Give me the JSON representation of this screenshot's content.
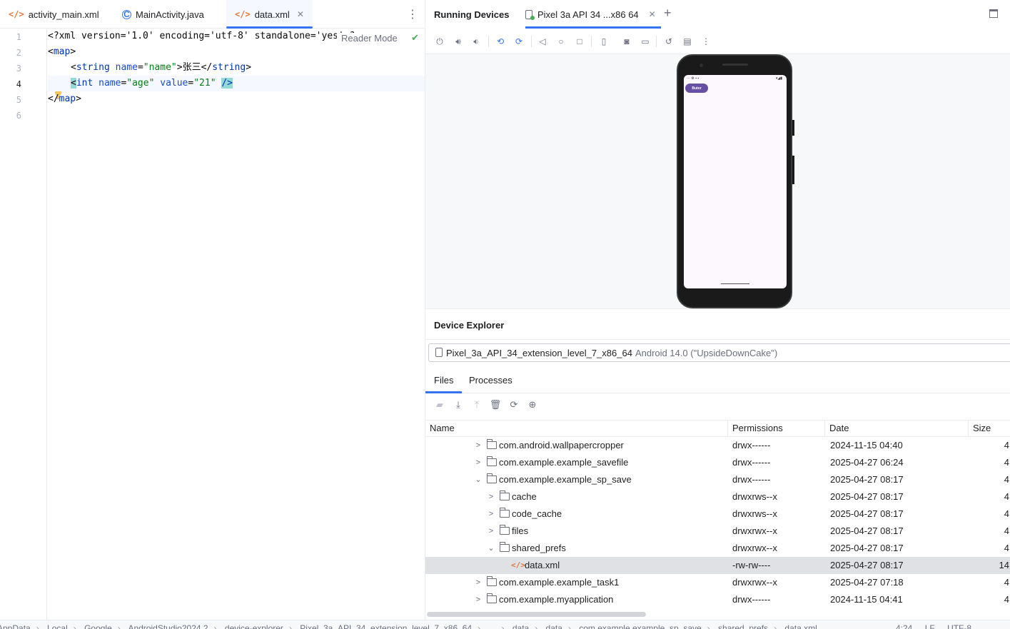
{
  "editor": {
    "tabs": [
      {
        "label": "activity_main.xml",
        "icon": "xml-file-icon",
        "active": false
      },
      {
        "label": "MainActivity.java",
        "icon": "java-class-icon",
        "active": false
      },
      {
        "label": "data.xml",
        "icon": "xml-file-icon",
        "active": true
      }
    ],
    "reader_mode": "Reader Mode",
    "line_numbers": [
      "1",
      "2",
      "3",
      "4",
      "5",
      "6"
    ],
    "current_line": 4,
    "lines": {
      "l1": "<?xml version='1.0' encoding='utf-8' standalone='yes' ?>",
      "l2_open": "<",
      "l2_tag": "map",
      "l2_close": ">",
      "l3_open": "<",
      "l3_tag": "string",
      "l3_attr": "name",
      "l3_eq": "=",
      "l3_val": "\"name\"",
      "l3_close": ">",
      "l3_text": "张三",
      "l3_end_open": "</",
      "l3_end_tag": "string",
      "l3_end_close": ">",
      "l4_open": "<",
      "l4_tag": "int",
      "l4_attr1": "name",
      "l4_eq1": "=",
      "l4_val1": "\"age\"",
      "l4_attr2": "value",
      "l4_eq2": "=",
      "l4_val2": "\"21\"",
      "l4_close": "/>",
      "l5_open": "</",
      "l5_tag": "map",
      "l5_close": ">"
    }
  },
  "running_devices": {
    "title": "Running Devices",
    "device_tab": "Pixel 3a API 34 ...x86 64",
    "toolbar_icons": [
      "power-icon",
      "volume-up-icon",
      "volume-down-icon",
      "rotate-left-icon",
      "rotate-right-icon",
      "back-icon",
      "home-icon",
      "overview-icon",
      "device-frame-icon",
      "screenshot-icon",
      "screen-record-icon",
      "reset-icon",
      "snapshot-icon",
      "more-icon"
    ],
    "app_button_label": "Butor"
  },
  "device_explorer": {
    "title": "Device Explorer",
    "device_name": "Pixel_3a_API_34_extension_level_7_x86_64",
    "device_os": "Android 14.0 (\"UpsideDownCake\")",
    "tabs": [
      "Files",
      "Processes"
    ],
    "columns": [
      "Name",
      "Permissions",
      "Date",
      "Size"
    ],
    "rows": [
      {
        "name": "com.android.wallpapercropper",
        "perm": "drwx------",
        "date": "2024-11-15 04:40",
        "size": "4",
        "level": 0,
        "type": "folder",
        "expanded": false
      },
      {
        "name": "com.example.example_savefile",
        "perm": "drwx------",
        "date": "2025-04-27 06:24",
        "size": "4",
        "level": 0,
        "type": "folder",
        "expanded": false
      },
      {
        "name": "com.example.example_sp_save",
        "perm": "drwx------",
        "date": "2025-04-27 08:17",
        "size": "4",
        "level": 0,
        "type": "folder",
        "expanded": true
      },
      {
        "name": "cache",
        "perm": "drwxrws--x",
        "date": "2025-04-27 08:17",
        "size": "4",
        "level": 1,
        "type": "folder",
        "expanded": false
      },
      {
        "name": "code_cache",
        "perm": "drwxrws--x",
        "date": "2025-04-27 08:17",
        "size": "4",
        "level": 1,
        "type": "folder",
        "expanded": false
      },
      {
        "name": "files",
        "perm": "drwxrwx--x",
        "date": "2025-04-27 08:17",
        "size": "4",
        "level": 1,
        "type": "folder",
        "expanded": false
      },
      {
        "name": "shared_prefs",
        "perm": "drwxrwx--x",
        "date": "2025-04-27 08:17",
        "size": "4",
        "level": 1,
        "type": "folder",
        "expanded": true
      },
      {
        "name": "data.xml",
        "perm": "-rw-rw----",
        "date": "2025-04-27 08:17",
        "size": "14",
        "level": 2,
        "type": "xml",
        "expanded": false,
        "selected": true
      },
      {
        "name": "com.example.example_task1",
        "perm": "drwxrwx--x",
        "date": "2025-04-27 07:18",
        "size": "4",
        "level": 0,
        "type": "folder",
        "expanded": false
      },
      {
        "name": "com.example.myapplication",
        "perm": "drwx------",
        "date": "2024-11-15 04:41",
        "size": "4",
        "level": 0,
        "type": "folder",
        "expanded": false
      }
    ]
  },
  "status_bar": {
    "breadcrumbs": [
      "AppData",
      "Local",
      "Google",
      "AndroidStudio2024.2",
      "device-explorer",
      "Pixel_3a_API_34_extension_level_7_x86_64",
      "...",
      "data",
      "data",
      "com.example.example_sp_save",
      "shared_prefs",
      "data.xml"
    ],
    "position": "4:24",
    "line_sep": "LF",
    "encoding": "UTF-8"
  }
}
